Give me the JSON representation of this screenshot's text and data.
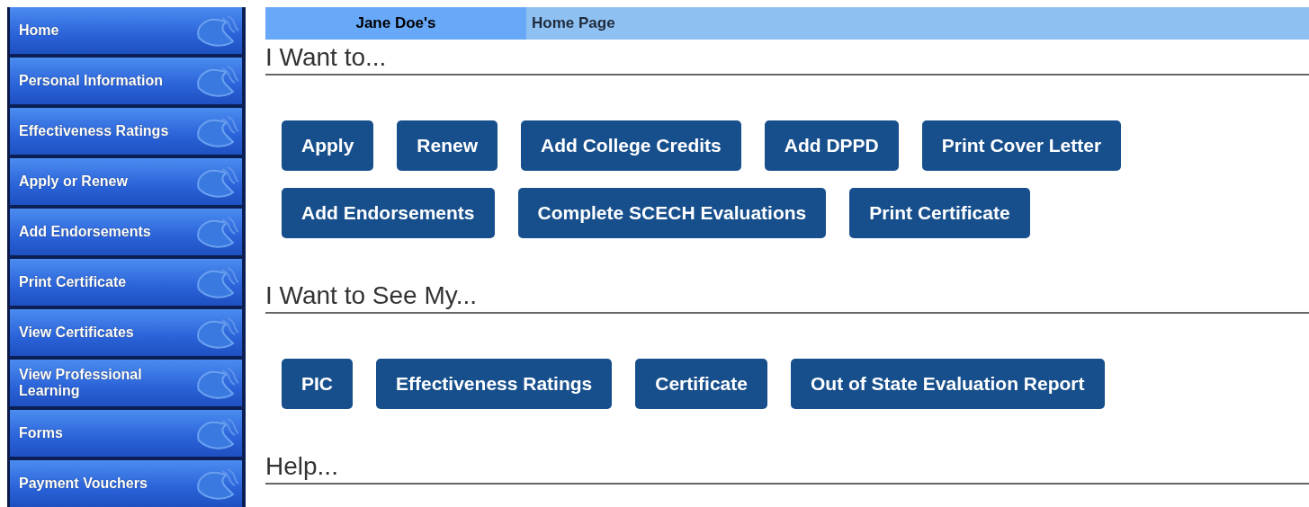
{
  "sidebar": {
    "items": [
      {
        "label": "Home"
      },
      {
        "label": "Personal Information"
      },
      {
        "label": "Effectiveness Ratings"
      },
      {
        "label": "Apply or Renew"
      },
      {
        "label": "Add Endorsements"
      },
      {
        "label": "Print Certificate"
      },
      {
        "label": "View Certificates"
      },
      {
        "label": "View Professional Learning"
      },
      {
        "label": "Forms"
      },
      {
        "label": "Payment Vouchers"
      }
    ]
  },
  "header": {
    "name": "Jane Doe's",
    "title": "Home Page"
  },
  "sections": [
    {
      "heading": "I Want to...",
      "button_rows": [
        [
          "Apply",
          "Renew",
          "Add College Credits",
          "Add DPPD",
          "Print Cover Letter"
        ],
        [
          "Add Endorsements",
          "Complete SCECH Evaluations",
          "Print Certificate"
        ]
      ]
    },
    {
      "heading": "I Want to See My...",
      "button_rows": [
        [
          "PIC",
          "Effectiveness Ratings",
          "Certificate",
          "Out of State Evaluation Report"
        ]
      ]
    },
    {
      "heading": "Help..."
    }
  ]
}
